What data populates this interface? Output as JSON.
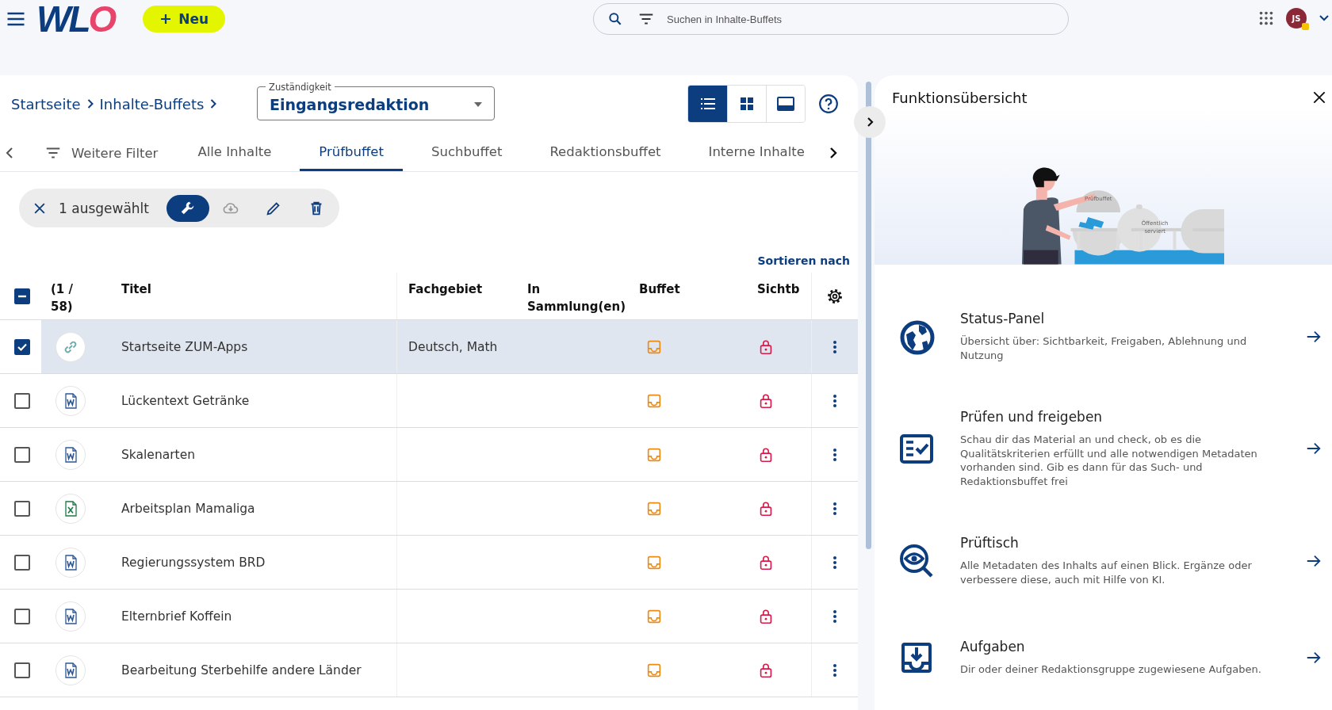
{
  "header": {
    "logo": [
      {
        "text": "WL",
        "color": "#0c3d7e"
      },
      {
        "text": "O",
        "color": "#e8436b"
      }
    ],
    "new_button": "Neu",
    "search": {
      "placeholder": "Suchen in Inhalte-Buffets"
    },
    "avatar": "JS"
  },
  "breadcrumb": [
    "Startseite",
    "Inhalte-Buffets"
  ],
  "responsibility": {
    "label": "Zuständigkeit",
    "value": "Eingangsredaktion"
  },
  "view_modes": [
    {
      "kind": "list",
      "selected": true
    },
    {
      "kind": "grid",
      "selected": false
    },
    {
      "kind": "preview",
      "selected": false
    }
  ],
  "filter_button": "Weitere Filter",
  "tabs": [
    {
      "label": "Alle Inhalte",
      "selected": false
    },
    {
      "label": "Prüfbuffet",
      "selected": true
    },
    {
      "label": "Suchbuffet",
      "selected": false
    },
    {
      "label": "Redaktionsbuffet",
      "selected": false
    },
    {
      "label": "Interne Inhalte",
      "selected": false
    }
  ],
  "selection": {
    "count": "1 ausgewählt",
    "actions": [
      {
        "kind": "wrench",
        "selected": true,
        "disabled": false
      },
      {
        "kind": "cloud",
        "selected": false,
        "disabled": true
      },
      {
        "kind": "pencil",
        "selected": false,
        "disabled": false
      },
      {
        "kind": "trash",
        "selected": false,
        "disabled": false
      }
    ]
  },
  "sort_label": "Sortieren nach",
  "table": {
    "select_all": {
      "indeterminate": true
    },
    "columns": [
      "(1 / 58)",
      "Titel",
      "Fachgebiet",
      "In Sammlung(en)",
      "Buffet",
      "Sichtb"
    ],
    "rows": [
      {
        "checked": true,
        "kind": "link",
        "title": "Startseite ZUM-Apps",
        "subject": "Deutsch, Math"
      },
      {
        "checked": false,
        "kind": "word",
        "title": "Lückentext Getränke"
      },
      {
        "checked": false,
        "kind": "word",
        "title": "Skalenarten"
      },
      {
        "checked": false,
        "kind": "excel",
        "title": "Arbeitsplan Mamaliga"
      },
      {
        "checked": false,
        "kind": "word",
        "title": "Regierungssystem BRD"
      },
      {
        "checked": false,
        "kind": "word",
        "title": "Elternbrief Koffein"
      },
      {
        "checked": false,
        "kind": "word",
        "title": "Bearbeitung Sterbehilfe andere Länder"
      }
    ]
  },
  "panel": {
    "title": "Funktionsübersicht",
    "illustration_labels": [
      [
        "Prüfbuffet"
      ],
      [
        "Öffentlich",
        "serviert"
      ]
    ],
    "features": [
      {
        "kind": "globe",
        "title": "Status-Panel",
        "description": "Übersicht über: Sichtbarkeit, Freigaben, Ablehnung und Nutzung"
      },
      {
        "kind": "checklist",
        "title": "Prüfen und freigeben",
        "description": "Schau dir das Material an und check, ob es die Qualitätskriterien erfüllt und alle notwendigen Metadaten vorhanden sind. Gib es dann für das Such- und Redaktionsbuffet frei"
      },
      {
        "kind": "inspect",
        "title": "Prüftisch",
        "description": "Alle Metadaten des Inhalts auf einen Blick. Ergänze oder verbessere diese, auch mit Hilfe von KI."
      },
      {
        "kind": "tasks",
        "title": "Aufgaben",
        "description": "Dir oder deiner Redaktionsgruppe zugewiesene Aufgaben."
      }
    ]
  }
}
